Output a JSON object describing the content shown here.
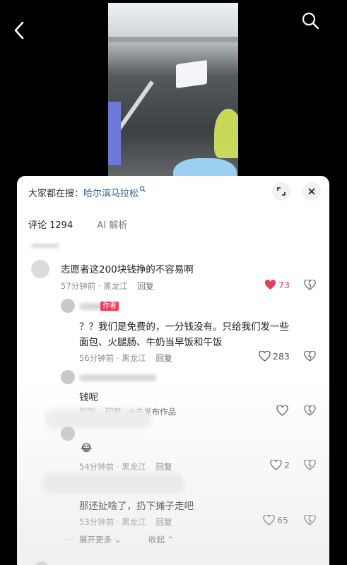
{
  "header": {
    "back_icon": "arrow-left-icon",
    "search_icon": "search-icon"
  },
  "sheet": {
    "hot_search_prefix": "大家都在搜：",
    "hot_search_keyword": "哈尔滨马拉松",
    "tabs": {
      "comments": "评论 1294",
      "ai": "AI 解析"
    }
  },
  "comments": [
    {
      "text": "志愿者这200块钱挣的不容易啊",
      "time": "57分钟前 · 黑龙江",
      "reply": "回复",
      "likes": "73",
      "liked": true
    },
    {
      "author_tag": "作者",
      "text_line1": "？？我们是免费的，一分钱没有。只给我们发一些",
      "text_line2": "面包、火腿肠、牛奶当早饭和午饭",
      "time": "56分钟前 · 黑龙江",
      "reply": "回复",
      "likes": "283"
    },
    {
      "text": "钱呢",
      "time": "刚刚",
      "reply": "回复",
      "publish": "去发布作品"
    },
    {
      "emoji": "😂",
      "time": "54分钟前 · 黑龙江",
      "reply": "回复",
      "likes": "2"
    },
    {
      "text": "那还扯啥了，扔下摊子走吧",
      "time": "53分钟前 · 黑龙江",
      "reply": "回复",
      "likes": "65"
    }
  ],
  "footer": {
    "expand_more": "展开更多",
    "collapse": "收起"
  },
  "colors": {
    "like_red": "#e0415a",
    "author_tag": "#f23a5a",
    "keyword": "#2a5a9c"
  }
}
